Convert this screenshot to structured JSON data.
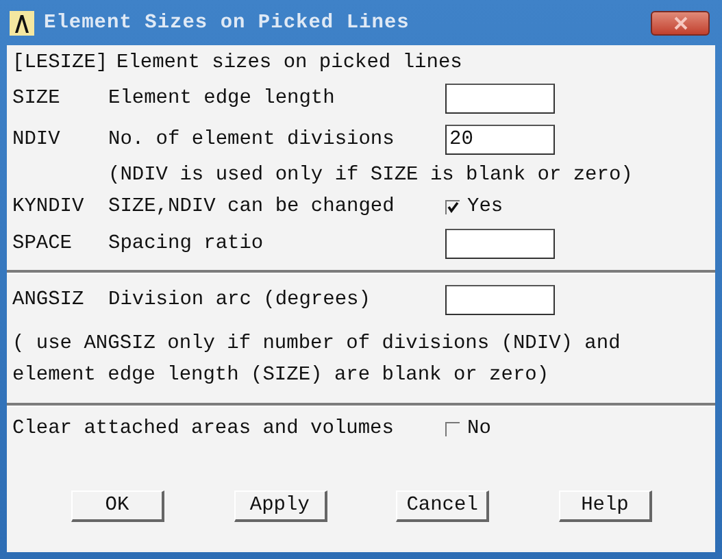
{
  "window": {
    "title": "Element Sizes on Picked Lines"
  },
  "header": {
    "code": "[LESIZE]",
    "text": "Element sizes on picked lines"
  },
  "rows": [
    {
      "kind": "field",
      "code": "SIZE",
      "label": "Element edge length",
      "value": ""
    },
    {
      "kind": "field",
      "code": "NDIV",
      "label": "No. of element divisions",
      "value": "20"
    },
    {
      "kind": "note",
      "text": "(NDIV is used only if SIZE is blank or zero)"
    },
    {
      "kind": "check",
      "code": "KYNDIV",
      "label": "SIZE,NDIV can be changed",
      "checked": true,
      "state_label": "Yes"
    },
    {
      "kind": "field",
      "code": "SPACE",
      "label": "Spacing ratio",
      "value": ""
    },
    {
      "kind": "divider"
    },
    {
      "kind": "field",
      "code": "ANGSIZ",
      "label": "Division arc (degrees)",
      "value": ""
    },
    {
      "kind": "para",
      "text": "( use ANGSIZ only if number of divisions (NDIV) and element edge length (SIZE) are blank or zero)"
    },
    {
      "kind": "divider"
    },
    {
      "kind": "check",
      "label": "Clear attached areas and volumes",
      "checked": false,
      "state_label": "No"
    }
  ],
  "buttons": [
    "OK",
    "Apply",
    "Cancel",
    "Help"
  ]
}
